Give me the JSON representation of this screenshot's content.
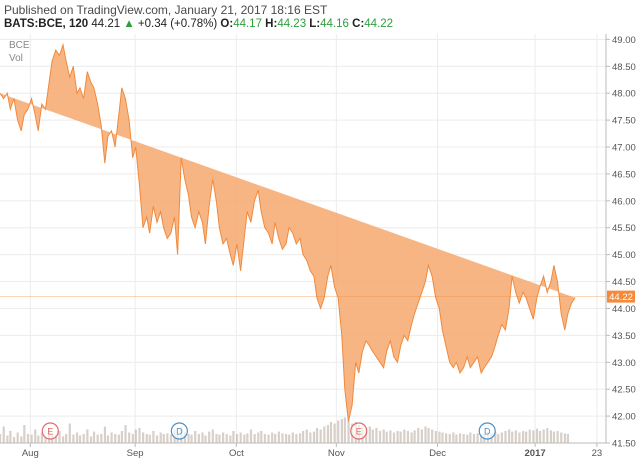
{
  "header": {
    "published": "Published on TradingView.com, January 21, 2017 18:16 EST",
    "symbol": "BATS:BCE, 120",
    "last": "44.21",
    "change_arrow": "▲",
    "change": "+0.34 (+0.78%)",
    "open_label": "O:",
    "open": "44.17",
    "high_label": "H:",
    "high": "44.23",
    "low_label": "L:",
    "low": "44.16",
    "close_label": "C:",
    "close": "44.22"
  },
  "legend": {
    "symbol": "BCE",
    "volume": "Vol"
  },
  "colors": {
    "area_fill": "#f7a86e",
    "area_line": "#f08a3c",
    "price_badge": "#f58a3c",
    "earnings_marker": "#e46a6a",
    "dividend_marker": "#4a90c8"
  },
  "chart_data": {
    "type": "area",
    "ylim": [
      41.5,
      49.1
    ],
    "y_ticks": [
      "49.00",
      "48.50",
      "48.00",
      "47.50",
      "47.00",
      "46.50",
      "46.00",
      "45.50",
      "45.00",
      "44.50",
      "44.00",
      "43.50",
      "43.00",
      "42.50",
      "42.00",
      "41.50"
    ],
    "x_ticks": [
      {
        "label": "Aug",
        "x": 0.05,
        "bold": false
      },
      {
        "label": "Sep",
        "x": 0.223,
        "bold": false
      },
      {
        "label": "Oct",
        "x": 0.39,
        "bold": false
      },
      {
        "label": "Nov",
        "x": 0.555,
        "bold": false
      },
      {
        "label": "Dec",
        "x": 0.722,
        "bold": false
      },
      {
        "label": "2017",
        "x": 0.883,
        "bold": true
      },
      {
        "label": "23",
        "x": 0.985,
        "bold": false
      }
    ],
    "last_price": "44.22",
    "last_value": 44.22,
    "x": [
      0.0,
      0.006,
      0.012,
      0.017,
      0.023,
      0.029,
      0.035,
      0.04,
      0.046,
      0.052,
      0.058,
      0.063,
      0.069,
      0.075,
      0.081,
      0.086,
      0.092,
      0.098,
      0.104,
      0.109,
      0.115,
      0.121,
      0.127,
      0.132,
      0.138,
      0.144,
      0.15,
      0.155,
      0.161,
      0.167,
      0.173,
      0.178,
      0.184,
      0.19,
      0.196,
      0.201,
      0.207,
      0.213,
      0.219,
      0.224,
      0.23,
      0.236,
      0.242,
      0.247,
      0.253,
      0.259,
      0.265,
      0.27,
      0.276,
      0.282,
      0.288,
      0.293,
      0.299,
      0.305,
      0.311,
      0.316,
      0.322,
      0.328,
      0.334,
      0.339,
      0.345,
      0.351,
      0.357,
      0.362,
      0.368,
      0.374,
      0.38,
      0.385,
      0.391,
      0.397,
      0.403,
      0.408,
      0.414,
      0.42,
      0.426,
      0.431,
      0.437,
      0.443,
      0.449,
      0.454,
      0.46,
      0.466,
      0.472,
      0.477,
      0.483,
      0.489,
      0.495,
      0.5,
      0.506,
      0.512,
      0.518,
      0.523,
      0.529,
      0.535,
      0.541,
      0.546,
      0.552,
      0.558,
      0.564,
      0.569,
      0.575,
      0.581,
      0.587,
      0.592,
      0.598,
      0.604,
      0.61,
      0.615,
      0.621,
      0.627,
      0.633,
      0.638,
      0.644,
      0.65,
      0.656,
      0.661,
      0.667,
      0.673,
      0.679,
      0.684,
      0.69,
      0.696,
      0.702,
      0.707,
      0.713,
      0.719,
      0.725,
      0.73,
      0.736,
      0.742,
      0.748,
      0.753,
      0.759,
      0.765,
      0.771,
      0.776,
      0.782,
      0.788,
      0.794,
      0.799,
      0.805,
      0.811,
      0.817,
      0.822,
      0.828,
      0.834,
      0.84,
      0.845,
      0.851,
      0.857,
      0.863,
      0.868,
      0.874,
      0.88,
      0.886,
      0.891,
      0.897,
      0.903,
      0.909,
      0.914,
      0.92,
      0.926,
      0.932,
      0.937,
      0.943,
      0.949,
      0.955,
      0.96,
      0.966,
      0.972,
      0.978,
      0.983,
      0.99,
      1.0
    ],
    "values": [
      48.0,
      47.9,
      48.0,
      47.7,
      47.9,
      47.5,
      47.3,
      47.6,
      47.7,
      47.9,
      47.6,
      47.3,
      47.8,
      47.7,
      48.2,
      48.6,
      48.8,
      48.7,
      48.9,
      48.6,
      48.3,
      48.5,
      48.0,
      48.1,
      47.9,
      48.4,
      48.2,
      48.1,
      47.8,
      47.4,
      46.7,
      47.2,
      47.3,
      47.0,
      47.6,
      48.1,
      47.9,
      47.5,
      46.8,
      47.0,
      46.3,
      45.5,
      45.7,
      45.4,
      45.9,
      45.6,
      45.8,
      45.5,
      45.3,
      45.4,
      45.7,
      45.0,
      46.8,
      46.4,
      46.1,
      45.7,
      45.5,
      45.8,
      45.6,
      45.2,
      45.9,
      46.4,
      46.0,
      45.5,
      45.2,
      45.3,
      45.0,
      44.8,
      45.2,
      44.7,
      45.3,
      45.8,
      45.6,
      46.0,
      46.2,
      45.8,
      45.5,
      45.4,
      45.2,
      45.6,
      45.3,
      45.1,
      45.2,
      45.5,
      45.4,
      45.2,
      45.3,
      45.0,
      44.9,
      44.7,
      44.6,
      44.2,
      44.0,
      44.2,
      44.6,
      44.8,
      44.4,
      44.2,
      43.5,
      42.5,
      41.9,
      42.2,
      43.0,
      42.8,
      43.2,
      43.4,
      43.3,
      43.2,
      43.1,
      43.0,
      42.9,
      43.2,
      43.4,
      43.1,
      43.0,
      43.3,
      43.5,
      43.4,
      43.7,
      43.9,
      44.1,
      44.3,
      44.5,
      44.8,
      44.6,
      44.2,
      44.0,
      43.6,
      43.3,
      43.0,
      42.9,
      43.0,
      42.8,
      42.9,
      43.1,
      42.9,
      43.0,
      43.1,
      42.8,
      42.9,
      43.0,
      43.1,
      43.3,
      43.5,
      43.7,
      43.6,
      44.0,
      44.6,
      44.3,
      44.1,
      44.3,
      44.2,
      44.0,
      43.8,
      44.2,
      44.4,
      44.6,
      44.3,
      44.5,
      44.8,
      44.5,
      43.9,
      43.6,
      43.9,
      44.1,
      44.2
    ],
    "volume": [
      0.3,
      0.55,
      0.25,
      0.4,
      0.2,
      0.35,
      0.22,
      0.6,
      0.3,
      0.28,
      0.45,
      0.25,
      0.35,
      0.2,
      0.5,
      0.3,
      0.25,
      0.4,
      0.22,
      0.3,
      0.65,
      0.28,
      0.35,
      0.25,
      0.3,
      0.45,
      0.22,
      0.38,
      0.28,
      0.3,
      0.55,
      0.25,
      0.35,
      0.3,
      0.28,
      0.4,
      0.6,
      0.35,
      0.3,
      0.45,
      0.5,
      0.35,
      0.3,
      0.28,
      0.4,
      0.25,
      0.35,
      0.3,
      0.32,
      0.28,
      0.45,
      0.3,
      0.55,
      0.35,
      0.3,
      0.28,
      0.4,
      0.3,
      0.35,
      0.25,
      0.38,
      0.45,
      0.3,
      0.28,
      0.35,
      0.3,
      0.25,
      0.4,
      0.3,
      0.35,
      0.28,
      0.32,
      0.45,
      0.3,
      0.35,
      0.4,
      0.3,
      0.28,
      0.35,
      0.3,
      0.38,
      0.32,
      0.3,
      0.28,
      0.35,
      0.3,
      0.32,
      0.4,
      0.45,
      0.35,
      0.38,
      0.5,
      0.45,
      0.55,
      0.6,
      0.7,
      0.65,
      0.75,
      0.8,
      0.85,
      0.75,
      0.65,
      0.7,
      0.6,
      0.55,
      0.5,
      0.55,
      0.45,
      0.5,
      0.4,
      0.45,
      0.38,
      0.42,
      0.35,
      0.4,
      0.38,
      0.45,
      0.4,
      0.35,
      0.42,
      0.5,
      0.45,
      0.55,
      0.5,
      0.45,
      0.4,
      0.38,
      0.35,
      0.32,
      0.3,
      0.35,
      0.28,
      0.32,
      0.3,
      0.28,
      0.35,
      0.3,
      0.32,
      0.28,
      0.3,
      0.35,
      0.32,
      0.38,
      0.3,
      0.35,
      0.4,
      0.45,
      0.38,
      0.42,
      0.35,
      0.4,
      0.38,
      0.45,
      0.42,
      0.48,
      0.4,
      0.45,
      0.5,
      0.42,
      0.38,
      0.4,
      0.35,
      0.32,
      0.3
    ],
    "events": [
      {
        "type": "earnings",
        "label": "E",
        "x": 0.083
      },
      {
        "type": "dividend",
        "label": "D",
        "x": 0.296
      },
      {
        "type": "earnings",
        "label": "E",
        "x": 0.592
      },
      {
        "type": "dividend",
        "label": "D",
        "x": 0.804
      }
    ]
  }
}
